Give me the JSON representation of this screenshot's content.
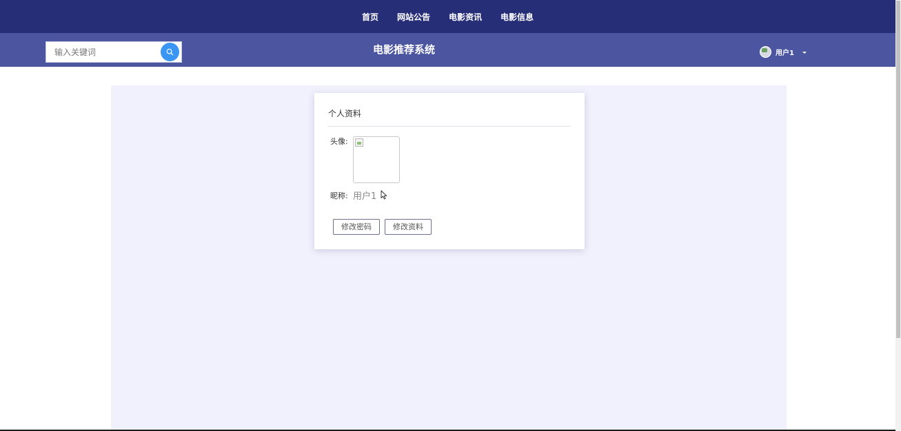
{
  "nav": {
    "items": [
      {
        "label": "首页"
      },
      {
        "label": "网站公告"
      },
      {
        "label": "电影资讯"
      },
      {
        "label": "电影信息"
      }
    ]
  },
  "header": {
    "search_placeholder": "输入关键词",
    "site_title": "电影推荐系统",
    "user_name": "用户1"
  },
  "profile": {
    "title": "个人资料",
    "avatar_label": "头像:",
    "nickname_label": "昵称:",
    "nickname_value": "用户1",
    "change_password_label": "修改密码",
    "edit_profile_label": "修改资料"
  },
  "colors": {
    "nav_bg": "#262e78",
    "header_bg": "#4c56a0",
    "content_bg": "#f1f1fd",
    "search_button": "#3a96f2"
  }
}
